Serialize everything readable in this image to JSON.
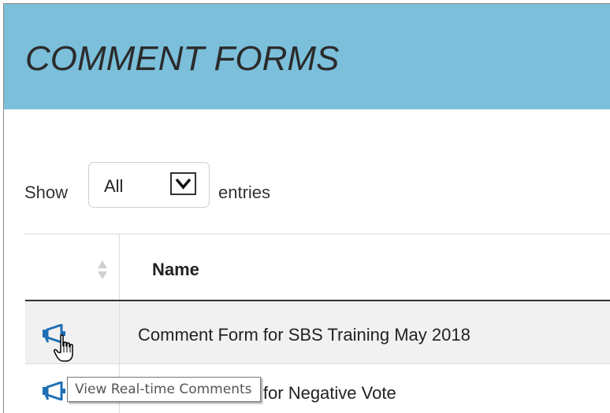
{
  "header": {
    "title": "COMMENT FORMS",
    "background_color": "#7bbfdb"
  },
  "length_control": {
    "show_label": "Show",
    "selected_value": "All",
    "entries_label": "entries",
    "dropdown_icon": "chevron-down-icon"
  },
  "table": {
    "columns": [
      {
        "label": "",
        "sort_icon": "sort-both-icon"
      },
      {
        "label": "Name"
      }
    ],
    "rows": [
      {
        "action_icon": "megaphone-icon",
        "name": "Comment Form for SBS Training May 2018"
      },
      {
        "action_icon": "megaphone-icon",
        "name": "Comment Form for Negative Vote"
      }
    ]
  },
  "tooltip": {
    "text": "View Real-time Comments"
  },
  "colors": {
    "accent_icon": "#1f6fb5",
    "striped_row": "#f1f1f1"
  }
}
